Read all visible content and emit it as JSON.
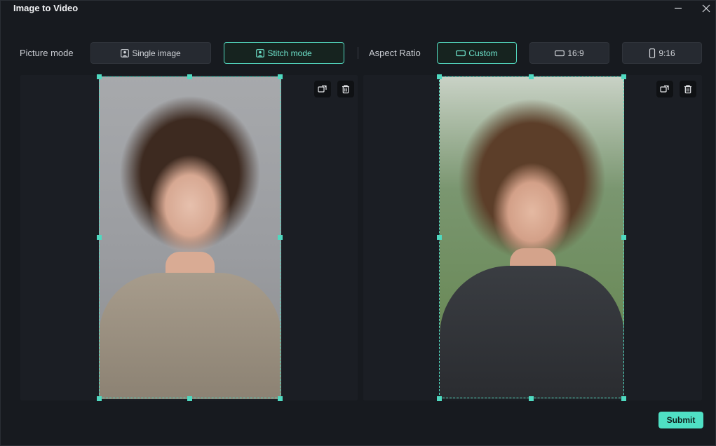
{
  "window": {
    "title": "Image to Video",
    "minimize_icon": "minimize-icon",
    "close_icon": "close-icon"
  },
  "picture_mode": {
    "label": "Picture mode",
    "options": [
      {
        "label": "Single image",
        "icon": "portrait-image-icon",
        "selected": false
      },
      {
        "label": "Stitch mode",
        "icon": "portrait-image-icon",
        "selected": true
      }
    ]
  },
  "aspect_ratio": {
    "label": "Aspect Ratio",
    "options": [
      {
        "label": "Custom",
        "icon": "landscape-rect-icon",
        "selected": true
      },
      {
        "label": "16:9",
        "icon": "landscape-rect-icon",
        "selected": false
      },
      {
        "label": "9:16",
        "icon": "portrait-rect-icon",
        "selected": false
      }
    ]
  },
  "images": [
    {
      "icons": [
        "replace-icon",
        "trash-icon"
      ]
    },
    {
      "icons": [
        "replace-icon",
        "trash-icon"
      ]
    }
  ],
  "footer": {
    "submit_label": "Submit"
  },
  "colors": {
    "accent": "#4fe0c4",
    "background": "#171a1f",
    "panel": "#1b1e24"
  }
}
